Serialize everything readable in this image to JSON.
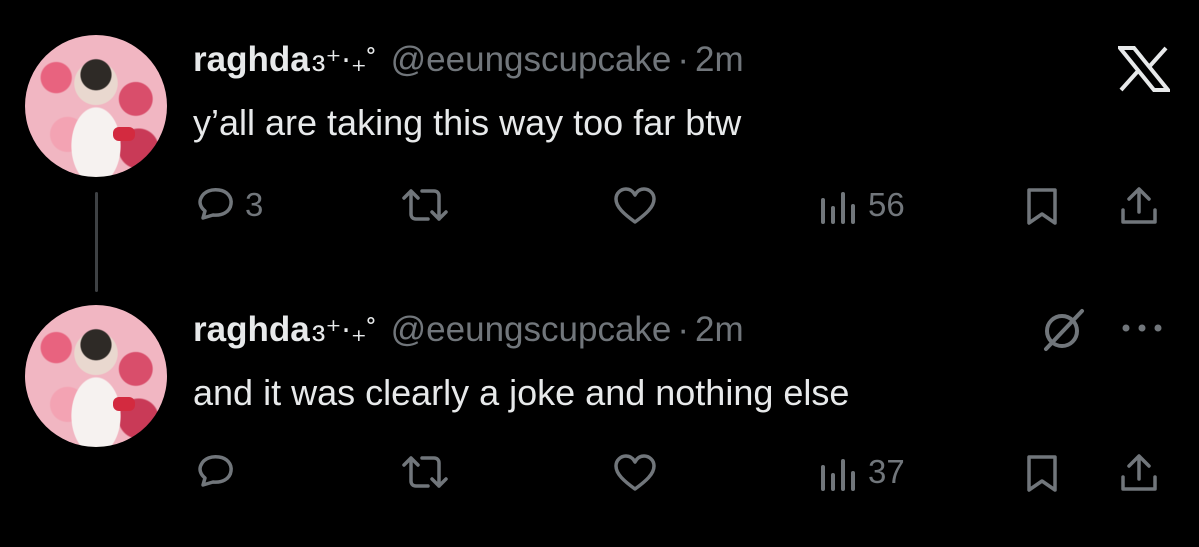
{
  "tweets": [
    {
      "author": {
        "display_name": "raghda",
        "name_decoration": "ɜ⁺‧₊˚",
        "handle": "@eeungscupcake"
      },
      "separator": "·",
      "time": "2m",
      "text": "y’all are taking this way too far btw",
      "top_icon": "x-logo-icon",
      "actions": {
        "reply_count": "3",
        "retweet_count": "",
        "like_count": "",
        "views_count": "56"
      }
    },
    {
      "author": {
        "display_name": "raghda",
        "name_decoration": "ɜ⁺‧₊˚",
        "handle": "@eeungscupcake"
      },
      "separator": "·",
      "time": "2m",
      "text": "and it was clearly a joke and nothing else",
      "top_icons": [
        "grok-icon",
        "more-options-icon"
      ],
      "actions": {
        "reply_count": "",
        "retweet_count": "",
        "like_count": "",
        "views_count": "37"
      }
    }
  ],
  "colors": {
    "background": "#000000",
    "primary_text": "#e7e9ea",
    "secondary_text": "#71767b",
    "thread_line": "#3e4144"
  }
}
